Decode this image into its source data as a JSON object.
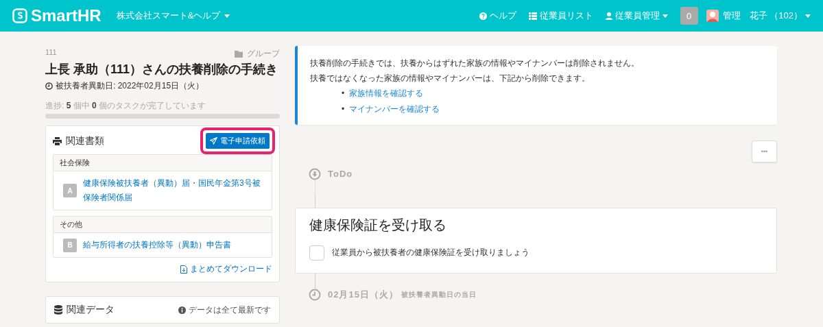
{
  "header": {
    "logo": "SmartHR",
    "company": "株式会社スマート&ヘルプ",
    "nav": [
      {
        "kind": "help",
        "label": "ヘルプ",
        "dropdown": false
      },
      {
        "kind": "list",
        "label": "従業員リスト",
        "dropdown": false
      },
      {
        "kind": "user",
        "label": "従業員管理",
        "dropdown": true
      }
    ],
    "notifications": "0",
    "account": "管理　花子 （102）"
  },
  "procedure": {
    "number": "111",
    "group": "グループ",
    "title": "上長 承助（111）さんの扶養削除の手続き",
    "date": "被扶養者異動日: 2022年02月15日（火）",
    "progress_text": "進捗: **5** 個中 **0** 個のタスクが完了しています",
    "level": 0
  },
  "documents": {
    "title": "関連書類",
    "action": "電子申請依頼",
    "action_highlighted": true,
    "groups": [
      {
        "name": "社会保険",
        "docs": [
          {
            "letter": "A",
            "title": "健康保険被扶養者（異動）届・国民年金第3号被保険者関係届"
          }
        ]
      },
      {
        "name": "その他",
        "docs": [
          {
            "letter": "B",
            "title": "給与所得者の扶養控除等（異動）申告書"
          }
        ]
      }
    ],
    "download": "まとめてダウンロード"
  },
  "related_data": {
    "title": "関連データ",
    "note": "データは全て最新です"
  },
  "notice": {
    "lines": [
      "扶養削除の手続きでは、扶養からはずれた家族の情報やマイナンバーは削除されません。",
      "扶養ではなくなった家族の情報やマイナンバーは、下記から削除できます。"
    ],
    "bullet": "•",
    "links": [
      "家族情報を確認する",
      "マイナンバーを確認する"
    ]
  },
  "more_button": "•••",
  "timeline": [
    {
      "kind": "status",
      "label": "ToDo"
    },
    {
      "kind": "task",
      "title": "健康保険証を受け取る",
      "items": [
        {
          "label": "従業員から被扶養者の健康保険証を受け取りましょう",
          "checked": false
        }
      ]
    },
    {
      "kind": "date",
      "label": "02月15日（火）",
      "sub": "被扶養者異動日の当日"
    }
  ]
}
